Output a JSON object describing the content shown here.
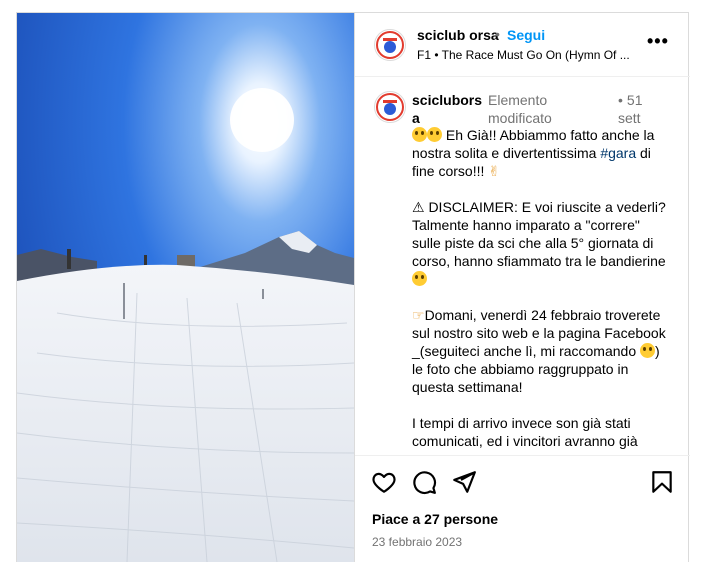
{
  "header": {
    "username": "sciclub​orsa",
    "username_plain": "sciclub orsa",
    "dot": "•",
    "follow_label": "Segui",
    "song": "F1 • The Race Must Go On (Hymn Of ...",
    "more": "•••"
  },
  "caption": {
    "username": "sciclubors a",
    "edited": "Elemento modificato",
    "time_dot": "•",
    "time": "51 sett",
    "line1_after_emoji": " Eh Già!! Abbiammo fatto anche la nostra solita e divertentissima ",
    "hashtag": "#gara",
    "line1_tail": " di fine corso!!! ",
    "para2_prefix": "⚠ DISCLAIMER: E voi riuscite a vederli? Talmente hanno imparato a \"correre\" sulle piste da sci che alla 5° giornata di corso, hanno sfiammato tra le bandierine ",
    "para3_prefix": "Domani, venerdì 24 febbraio troverete sul nostro sito web e la pagina Facebook _(seguiteci anche lì, mi raccomando ",
    "para3_suffix": ") le foto che abbiamo raggruppato in questa settimana!",
    "para4": "I tempi di arrivo invece son già stati comunicati, ed i vincitori avranno già"
  },
  "actions": {
    "like_icon": "heart-icon",
    "comment_icon": "comment-icon",
    "share_icon": "send-icon",
    "save_icon": "bookmark-icon",
    "likes": "Piace a 27 persone",
    "date": "23 febbraio 2023"
  },
  "colors": {
    "follow": "#0095f6",
    "hashtag": "#00376b",
    "muted": "#737373",
    "sky": "#2a6fe0"
  }
}
